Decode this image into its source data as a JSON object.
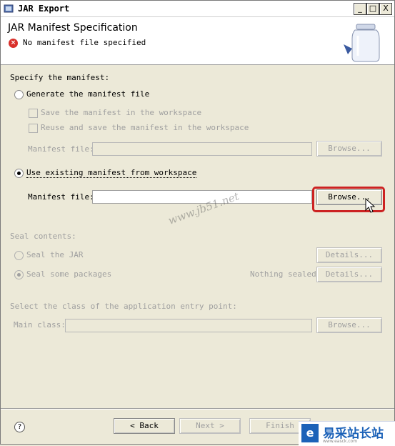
{
  "window": {
    "title": "JAR Export",
    "min_label": "_",
    "max_label": "□",
    "close_label": "X"
  },
  "header": {
    "title": "JAR Manifest Specification",
    "error_message": "No manifest file specified",
    "error_icon": "error-icon"
  },
  "manifest": {
    "section_label": "Specify the manifest:",
    "generate_label": "Generate the manifest file",
    "save_label": "Save the manifest in the workspace",
    "reuse_label": "Reuse and save the manifest in the workspace",
    "generate_file_label": "Manifest file:",
    "generate_file_value": "",
    "generate_browse": "Browse...",
    "existing_label": "Use existing manifest from workspace",
    "existing_file_label": "Manifest file:",
    "existing_file_value": "",
    "existing_browse": "Browse...",
    "selected": "existing"
  },
  "seal": {
    "section_label": "Seal contents:",
    "seal_jar_label": "Seal the JAR",
    "seal_jar_details": "Details...",
    "seal_some_label": "Seal some packages",
    "seal_some_status": "Nothing sealed",
    "seal_some_details": "Details...",
    "selected": "some"
  },
  "entry": {
    "section_label": "Select the class of the application entry point:",
    "main_class_label": "Main class:",
    "main_class_value": "",
    "browse": "Browse..."
  },
  "footer": {
    "help": "?",
    "back": "< Back",
    "next": "Next >",
    "finish": "Finish"
  },
  "watermark": {
    "text": "www.jb51.net"
  },
  "logo": {
    "mark": "e",
    "text": "易采站长站",
    "sub": "www.easck.com"
  },
  "colors": {
    "highlight": "#cc2222",
    "error": "#d9302b",
    "logo": "#1c62b8"
  }
}
